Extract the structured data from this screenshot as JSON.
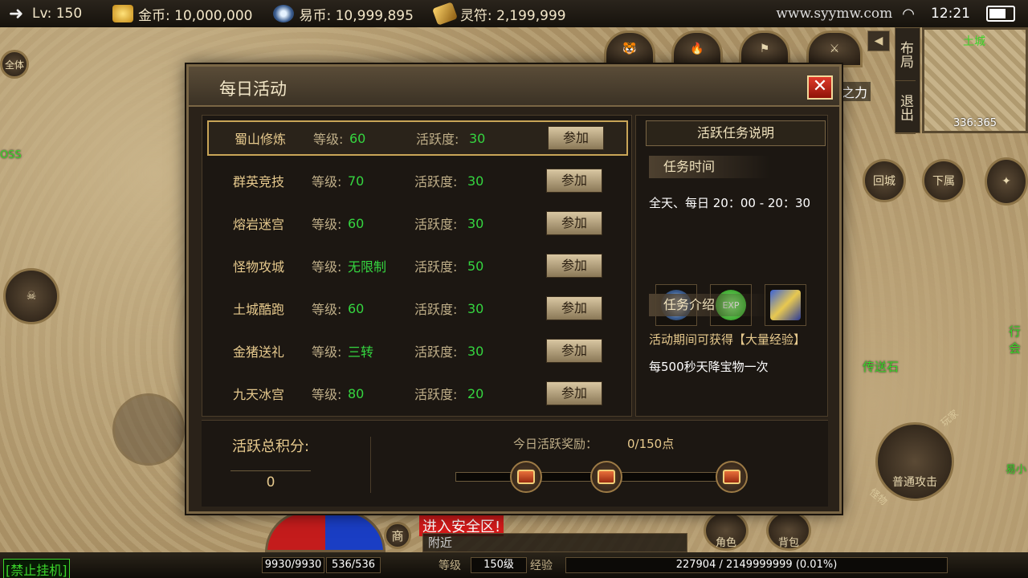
{
  "topbar": {
    "level": "Lv: 150",
    "gold_label": "金币: 10,000,000",
    "yibi_label": "易币: 10,999,895",
    "lingfu_label": "灵符: 2,199,999",
    "site": "www.syymw.com",
    "time": "12:21"
  },
  "side": {
    "quanti": "全体",
    "boss": "OSS",
    "layout_btn": "布局",
    "exit_btn": "退出",
    "minimap_name": "土城",
    "minimap_coords": "336:365",
    "huicheng": "回城",
    "xiashu": "下属",
    "chuansongshi": "传送石",
    "hang": "行会",
    "yixiao": "易小",
    "zhili": "之力",
    "attack": "普通攻击",
    "wanjia": "玩家",
    "guaiwu": "怪物",
    "role": "角色",
    "bag": "背包",
    "shop": "商",
    "chat_safe": "进入安全区!",
    "chat_nearby": "附近",
    "banned": "[禁止挂机]"
  },
  "hud": {
    "hp": "9930/9930",
    "mp": "536/536",
    "level_label": "等级",
    "level_val": "150级",
    "exp_label": "经验",
    "exp_val": "227904 / 2149999999 (0.01%)"
  },
  "dialog": {
    "title": "每日活动",
    "close": "✕",
    "level_label": "等级:",
    "activity_label": "活跃度:",
    "join_label": "参加",
    "activities": [
      {
        "name": "蜀山修炼",
        "level": "60",
        "activity": "30"
      },
      {
        "name": "群英竞技",
        "level": "70",
        "activity": "30"
      },
      {
        "name": "熔岩迷宫",
        "level": "60",
        "activity": "30"
      },
      {
        "name": "怪物攻城",
        "level": "无限制",
        "activity": "50"
      },
      {
        "name": "土城酷跑",
        "level": "60",
        "activity": "30"
      },
      {
        "name": "金猪送礼",
        "level": "三转",
        "activity": "30"
      },
      {
        "name": "九天冰宫",
        "level": "80",
        "activity": "20"
      }
    ],
    "info_title": "活跃任务说明",
    "time_tab": "任务时间",
    "time_text": "全天、每日 20：00 - 20：30",
    "intro_tab": "任务介绍",
    "intro_line1": "活动期间可获得【大量经验】",
    "intro_line2": "每500秒天降宝物一次",
    "score_label": "活跃总积分:",
    "score_value": "0",
    "reward_label": "今日活跃奖励：",
    "reward_progress": "0/150点",
    "reward_fraction": 0
  },
  "colors": {
    "green": "#35d640",
    "gold_text": "#e6c98d",
    "close_red": "#e03a2a"
  }
}
